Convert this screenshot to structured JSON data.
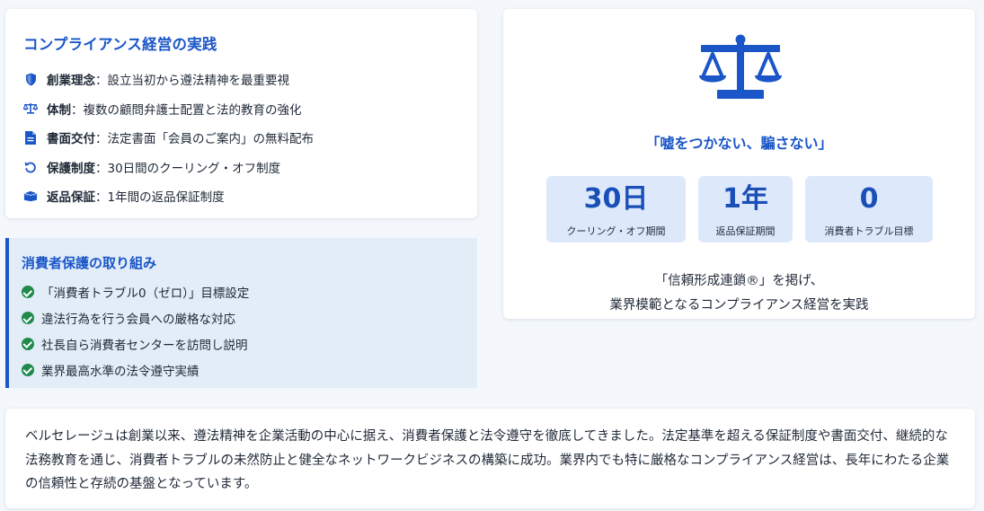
{
  "compliance": {
    "title": "コンプライアンス経営の実践",
    "items": [
      {
        "icon": "shield-icon",
        "label": "創業理念",
        "text": "：設立当初から遵法精神を最重要視"
      },
      {
        "icon": "scale-icon",
        "label": "体制",
        "text": "：複数の顧問弁護士配置と法的教育の強化"
      },
      {
        "icon": "document-icon",
        "label": "書面交付",
        "text": "：法定書面「会員のご案内」の無料配布"
      },
      {
        "icon": "undo-icon",
        "label": "保護制度",
        "text": "：30日間のクーリング・オフ制度"
      },
      {
        "icon": "box-icon",
        "label": "返品保証",
        "text": "：1年間の返品保証制度"
      }
    ]
  },
  "consumer": {
    "title": "消費者保護の取り組み",
    "items": [
      "「消費者トラブル0（ゼロ）」目標設定",
      "違法行為を行う会員への厳格な対応",
      "社長自ら消費者センターを訪問し説明",
      "業界最高水準の法令遵守実績"
    ]
  },
  "motto": {
    "quote": "「嘘をつかない、騙さない」",
    "stats": [
      {
        "value": "30日",
        "label": "クーリング・オフ期間"
      },
      {
        "value": "1年",
        "label": "返品保証期間"
      },
      {
        "value": "0",
        "label": "消費者トラブル目標"
      }
    ],
    "description_line1": "「信頼形成連鎖®」を掲げ、",
    "description_line2": "業界模範となるコンプライアンス経営を実践"
  },
  "summary": {
    "text": "ベルセレージュは創業以来、遵法精神を企業活動の中心に据え、消費者保護と法令遵守を徹底してきました。法定基準を超える保証制度や書面交付、継続的な法務教育を通じ、消費者トラブルの未然防止と健全なネットワークビジネスの構築に成功。業界内でも特に厳格なコンプライアンス経営は、長年にわたる企業の信頼性と存続の基盤となっています。"
  },
  "colors": {
    "accent": "#1a56c8",
    "check": "#1f8a4c",
    "stat_bg": "#dde9fb",
    "consumer_bg": "#e3edf8"
  }
}
